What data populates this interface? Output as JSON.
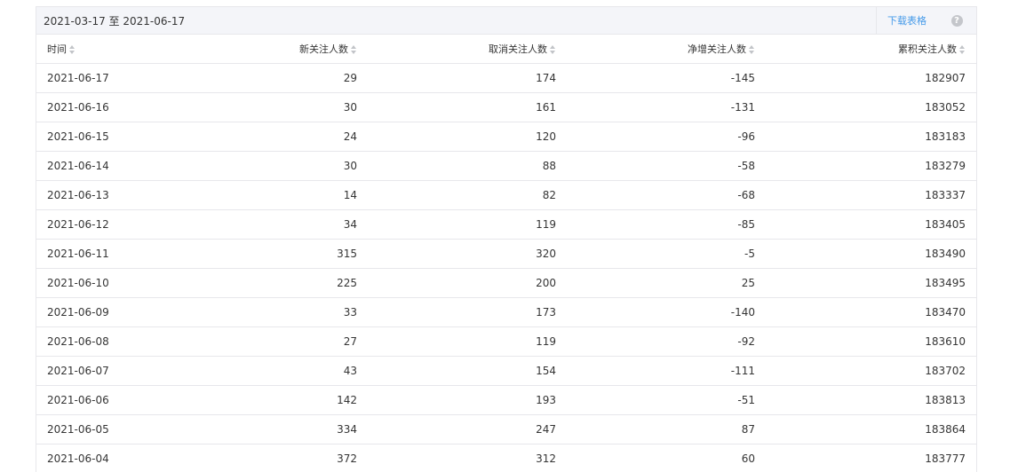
{
  "toolbar": {
    "date_range": "2021-03-17 至 2021-06-17",
    "download_label": "下载表格",
    "help_icon": "?"
  },
  "table": {
    "columns": [
      "时间",
      "新关注人数",
      "取消关注人数",
      "净增关注人数",
      "累积关注人数"
    ],
    "rows": [
      [
        "2021-06-17",
        "29",
        "174",
        "-145",
        "182907"
      ],
      [
        "2021-06-16",
        "30",
        "161",
        "-131",
        "183052"
      ],
      [
        "2021-06-15",
        "24",
        "120",
        "-96",
        "183183"
      ],
      [
        "2021-06-14",
        "30",
        "88",
        "-58",
        "183279"
      ],
      [
        "2021-06-13",
        "14",
        "82",
        "-68",
        "183337"
      ],
      [
        "2021-06-12",
        "34",
        "119",
        "-85",
        "183405"
      ],
      [
        "2021-06-11",
        "315",
        "320",
        "-5",
        "183490"
      ],
      [
        "2021-06-10",
        "225",
        "200",
        "25",
        "183495"
      ],
      [
        "2021-06-09",
        "33",
        "173",
        "-140",
        "183470"
      ],
      [
        "2021-06-08",
        "27",
        "119",
        "-92",
        "183610"
      ],
      [
        "2021-06-07",
        "43",
        "154",
        "-111",
        "183702"
      ],
      [
        "2021-06-06",
        "142",
        "193",
        "-51",
        "183813"
      ],
      [
        "2021-06-05",
        "334",
        "247",
        "87",
        "183864"
      ],
      [
        "2021-06-04",
        "372",
        "312",
        "60",
        "183777"
      ]
    ]
  },
  "colors": {
    "link": "#459ae9",
    "header_bg": "#f4f5f9",
    "border": "#e7e7eb",
    "text": "#353535"
  }
}
